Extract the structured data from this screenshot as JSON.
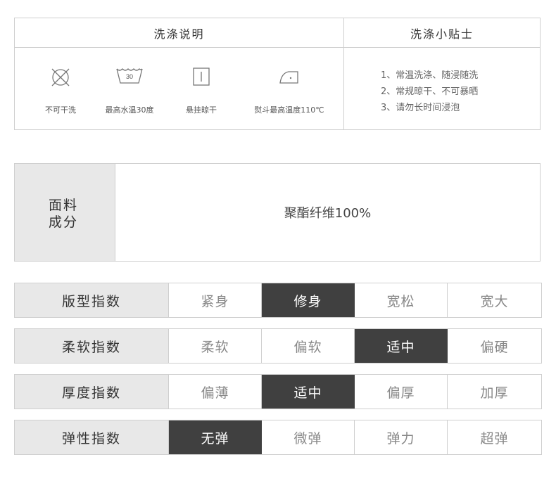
{
  "care": {
    "wash_header": "洗涤说明",
    "tips_header": "洗涤小贴士",
    "items": [
      {
        "icon": "no-dry-clean-icon",
        "label": "不可干洗"
      },
      {
        "icon": "wash-30-icon",
        "label": "最高水温30度",
        "temp": "30"
      },
      {
        "icon": "hang-dry-icon",
        "label": "悬挂晾干"
      },
      {
        "icon": "iron-icon",
        "label": "熨斗最高温度110℃"
      }
    ],
    "tips": [
      "1、常温洗涤、随浸随洗",
      "2、常规晾干、不可暴晒",
      "3、请勿长时间浸泡"
    ]
  },
  "fabric": {
    "label_line1": "面料",
    "label_line2": "成分",
    "value": "聚酯纤维100%"
  },
  "indices": [
    {
      "title": "版型指数",
      "options": [
        "紧身",
        "修身",
        "宽松",
        "宽大"
      ],
      "selected": 1
    },
    {
      "title": "柔软指数",
      "options": [
        "柔软",
        "偏软",
        "适中",
        "偏硬"
      ],
      "selected": 2
    },
    {
      "title": "厚度指数",
      "options": [
        "偏薄",
        "适中",
        "偏厚",
        "加厚"
      ],
      "selected": 1
    },
    {
      "title": "弹性指数",
      "options": [
        "无弹",
        "微弹",
        "弹力",
        "超弹"
      ],
      "selected": 0
    }
  ],
  "colors": {
    "selected_bg": "#404040",
    "label_bg": "#e8e8e8",
    "border": "#cfcfcf"
  }
}
